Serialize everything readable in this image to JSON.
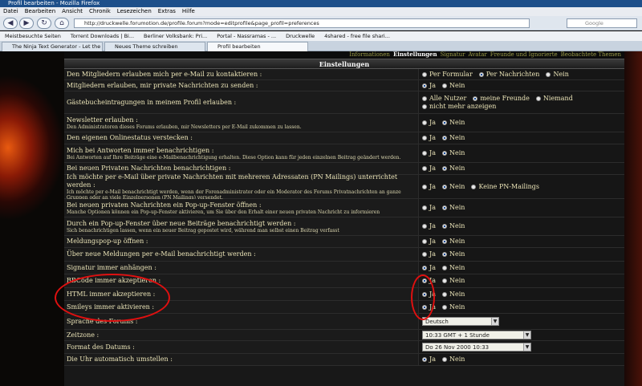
{
  "window": {
    "title": "Profil bearbeiten - Mozilla Firefox"
  },
  "menu": [
    "Datei",
    "Bearbeiten",
    "Ansicht",
    "Chronik",
    "Lesezeichen",
    "Extras",
    "Hilfe"
  ],
  "nav": {
    "url": "http://druckwelle.forumotion.de/profile.forum?mode=editprofile&page_profil=preferences",
    "search_placeholder": "Google"
  },
  "bookmarks": [
    "Meistbesuchte Seiten",
    "Torrent Downloads | Bi...",
    "Berliner Volksbank: Pri...",
    "Portal - Nassramas - ...",
    "Druckwelle",
    "4shared - free file shari..."
  ],
  "tabs": [
    {
      "label": "The Ninja Text Generator - Let the n...",
      "active": false
    },
    {
      "label": "Neues Theme schreiben",
      "active": false
    },
    {
      "label": "Profil bearbeiten",
      "active": true
    }
  ],
  "forum": {
    "nav_tabs": [
      "Informationen",
      "Einstellungen",
      "Signatur",
      "Avatar",
      "Freunde und Ignorierte",
      "Beobachtete Themen"
    ],
    "heading": "Einstellungen",
    "rows": [
      {
        "label": "Den Mitgliedern erlauben mich per e-Mail zu kontaktieren :",
        "opts": [
          "Per Formular",
          "Per Nachrichten",
          "Nein"
        ],
        "sel": 1
      },
      {
        "label": "Mitgliedern erlauben, mir private Nachrichten zu senden :",
        "opts": [
          "Ja",
          "Nein"
        ],
        "sel": 0
      },
      {
        "label": "Gästebucheintragungen in meinem Profil erlauben :",
        "opts": [
          "Alle Nutzer",
          "meine Freunde",
          "Niemand",
          "nicht mehr anzeigen"
        ],
        "sel": 1
      },
      {
        "label": "Newsletter erlauben :",
        "sub": "Den Administratoren dieses Forums erlauben, mir Newsletters per E-Mail zukommen zu lassen.",
        "opts": [
          "Ja",
          "Nein"
        ],
        "sel": 1
      },
      {
        "label": "Den eigenen Onlinestatus verstecken :",
        "opts": [
          "Ja",
          "Nein"
        ],
        "sel": 1
      },
      {
        "label": "Mich bei Antworten immer benachrichtigen :",
        "sub": "Bei Antworten auf Ihre Beiträge eine e-Mailbenachrichtigung erhalten. Diese Option kann für jeden einzelnen Beitrag geändert werden.",
        "opts": [
          "Ja",
          "Nein"
        ],
        "sel": 1
      },
      {
        "label": "Bei neuen Privaten Nachrichten benachrichtigen :",
        "opts": [
          "Ja",
          "Nein"
        ],
        "sel": 1
      },
      {
        "label": "Ich möchte per e-Mail über private Nachrichten mit mehreren Adressaten (PN Mailings) unterrichtet werden :",
        "sub": "Ich möchte per e-Mail benachrichtigt werden, wenn der Forenadministrator oder ein Moderator des Forums Privatnachrichten an ganze Gruppen oder an viele Einzelpersonen (PN Mailings) versendet.",
        "opts": [
          "Ja",
          "Nein",
          "Keine PN-Mailings"
        ],
        "sel": 1
      },
      {
        "label": "Bei neuen privaten Nachrichten ein Pop-up-Fenster öffnen :",
        "sub": "Manche Optionen können ein Pop-up-Fenster aktivieren, um Sie über den Erhalt einer neuen privaten Nachricht zu informieren",
        "opts": [
          "Ja",
          "Nein"
        ],
        "sel": 1
      },
      {
        "label": "Durch ein Pop-up-Fenster über neue Beiträge benachrichtigt werden :",
        "sub": "Sich benachrichtigen lassen, wenn ein neuer Beitrag gepostet wird, während man selbst einen Beitrag verfasst",
        "opts": [
          "Ja",
          "Nein"
        ],
        "sel": 1
      },
      {
        "label": "Meldungspop-up öffnen :",
        "opts": [
          "Ja",
          "Nein"
        ],
        "sel": 1
      },
      {
        "label": "Über neue Meldungen per e-Mail benachrichtigt werden :",
        "opts": [
          "Ja",
          "Nein"
        ],
        "sel": 1
      },
      {
        "label": "Signatur immer anhängen :",
        "opts": [
          "Ja",
          "Nein"
        ],
        "sel": 0
      },
      {
        "label": "BBCode immer akzeptieren :",
        "opts": [
          "Ja",
          "Nein"
        ],
        "sel": 0
      },
      {
        "label": "HTML immer akzeptieren :",
        "opts": [
          "Ja",
          "Nein"
        ],
        "sel": 0
      },
      {
        "label": "Smileys immer aktivieren :",
        "opts": [
          "Ja",
          "Nein"
        ],
        "sel": 0
      }
    ],
    "selects": [
      {
        "label": "Sprache des Forums :",
        "value": "Deutsch"
      },
      {
        "label": "Zeitzone :",
        "value": "10:33 GMT + 1 Stunde"
      },
      {
        "label": "Format des Datums :",
        "value": "Do 26 Nov 2000   10:33"
      }
    ],
    "last_row": {
      "label": "Die Uhr automatisch umstellen :",
      "opts": [
        "Ja",
        "Nein"
      ],
      "sel": 0
    }
  }
}
